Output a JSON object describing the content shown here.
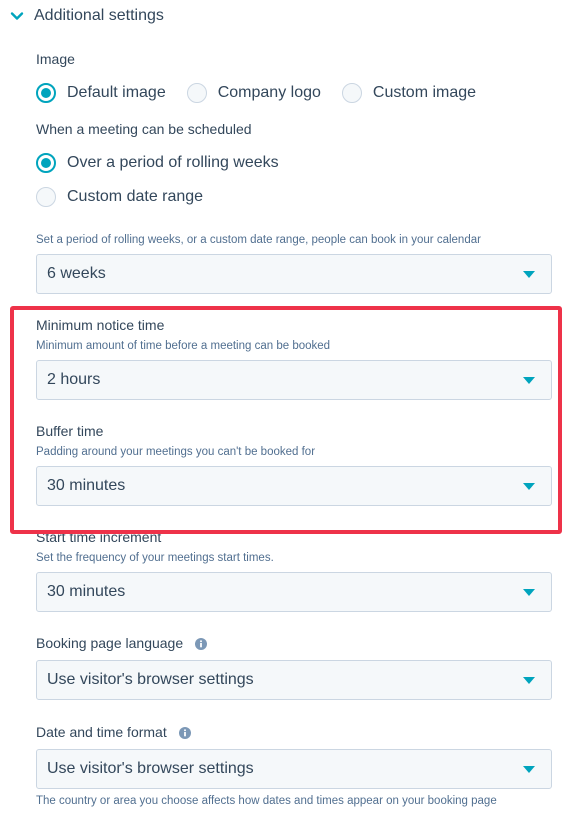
{
  "section": {
    "title": "Additional settings"
  },
  "image": {
    "label": "Image",
    "options": [
      "Default image",
      "Company logo",
      "Custom image"
    ],
    "selected": "Default image"
  },
  "schedule": {
    "label": "When a meeting can be scheduled",
    "options": [
      "Over a period of rolling weeks",
      "Custom date range"
    ],
    "selected": "Over a period of rolling weeks"
  },
  "rolling": {
    "help": "Set a period of rolling weeks, or a custom date range, people can book in your calendar",
    "value": "6 weeks"
  },
  "notice": {
    "label": "Minimum notice time",
    "help": "Minimum amount of time before a meeting can be booked",
    "value": "2 hours"
  },
  "buffer": {
    "label": "Buffer time",
    "help": "Padding around your meetings you can't be booked for",
    "value": "30 minutes"
  },
  "increment": {
    "label": "Start time increment",
    "help": "Set the frequency of your meetings start times.",
    "value": "30 minutes"
  },
  "language": {
    "label": "Booking page language",
    "value": "Use visitor's browser settings"
  },
  "datetime": {
    "label": "Date and time format",
    "value": "Use visitor's browser settings",
    "help": "The country or area you choose affects how dates and times appear on your booking page"
  },
  "colors": {
    "accent": "#00a4bd",
    "text": "#33475b",
    "highlight": "#ee3249",
    "field_bg": "#f5f8fa",
    "field_border": "#cbd6e2"
  },
  "icons": {
    "section_toggle": "chevron-down-icon",
    "dropdown": "caret-down-icon",
    "info": "info-icon"
  }
}
